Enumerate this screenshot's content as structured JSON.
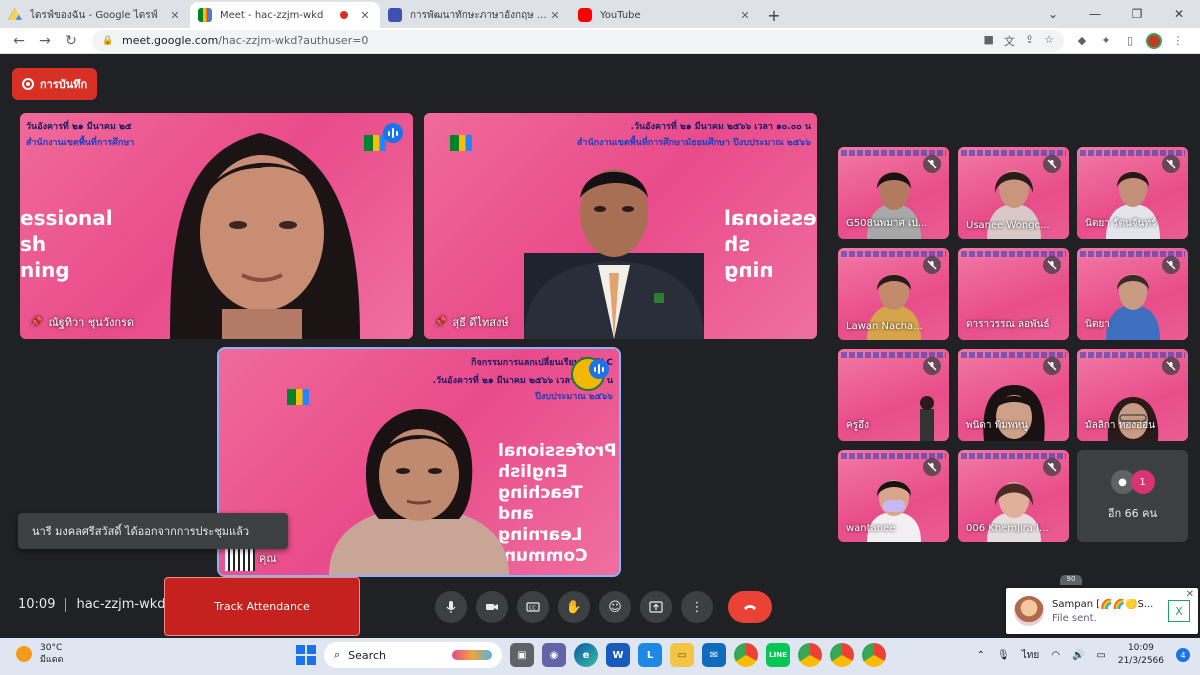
{
  "browser": {
    "tabs": [
      {
        "title": "ไดรฟ์ของฉัน - Google ไดรฟ์",
        "favicon": "drive-icon"
      },
      {
        "title": "Meet - hac-zzjm-wkd",
        "favicon": "meet-icon",
        "active": true,
        "recording": true
      },
      {
        "title": "การพัฒนาทักษะภาษาอังกฤษ English",
        "favicon": "forms-icon"
      },
      {
        "title": "YouTube",
        "favicon": "youtube-icon"
      }
    ],
    "url_host": "meet.google.com",
    "url_path": "/hac-zzjm-wkd?authuser=0"
  },
  "meet": {
    "recording_label": "การบันทึก",
    "main_tiles": [
      {
        "name": "ณัฐทิวา ชุนวังกรด",
        "banner": "วันอังคารที่ ๒๑ มีนาคม ๒๕",
        "banner2": "สำนักงานเขตพื้นที่การศึกษา",
        "slogan": [
          "essional",
          "sh",
          "ning"
        ]
      },
      {
        "name": "สุธี ดีไทสงษ์",
        "banner": "วันอังคารที่ ๒๑ มีนาคม ๒๕๖๖ เวลา ๑๐.๐๐ น.",
        "banner2": "สำนักงานเขตพื้นที่การศึกษามัธยมศึกษา ปีงบประมาณ ๒๕๖๖",
        "slogan": [
          "essional",
          "sh",
          "ning"
        ]
      },
      {
        "name": "คุณ",
        "banner": "กิจกรรมการแลกเปลี่ยนเรียนรู้ PELC",
        "banner2": "วันอังคารที่ ๒๑ มีนาคม ๒๕๖๖ เวลา ๑๐.๐๐ น.",
        "banner3": "ปีงบประมาณ ๒๕๖๖",
        "slogan": [
          "Professional",
          "English",
          "Teaching",
          "and",
          "Learning",
          "Communi"
        ]
      }
    ],
    "small_tiles": [
      {
        "name": "G508นพมาศ เป..."
      },
      {
        "name": "Usanee Wongc..."
      },
      {
        "name": "นิตยา รัตนจันทร์"
      },
      {
        "name": "Lawan Nacha..."
      },
      {
        "name": "ดาราวรรณ ลอพันธ์"
      },
      {
        "name": "นิตยา"
      },
      {
        "name": "ครูอึ่ง"
      },
      {
        "name": "พนิดา พิมพหนู"
      },
      {
        "name": "มัลลิกา ทองอ่อน"
      },
      {
        "name": "wantanee"
      },
      {
        "name": "006 Khemjira I..."
      }
    ],
    "more": {
      "count_badge": "1",
      "label": "อีก 66 คน"
    },
    "toast": "นารี มงคลศรีสวัสดิ์ ได้ออกจากการประชุมแล้ว",
    "time": "10:09",
    "meeting_code": "hac-zzjm-wkd",
    "track_attendance": "Track Attendance",
    "people_badge": "90",
    "chat": {
      "sender": "Sampan [🌈🌈🟡S...",
      "message": "File sent."
    }
  },
  "taskbar": {
    "temperature": "30°C",
    "condition": "มีแดด",
    "search": "Search",
    "lang": "ไทย",
    "time": "10:09",
    "date": "21/3/2566",
    "notif_count": "4"
  },
  "colors": {
    "meet_bg": "#202124",
    "record_red": "#d93025",
    "tile_pink": "#e84d8a",
    "hangup": "#ea4335"
  }
}
